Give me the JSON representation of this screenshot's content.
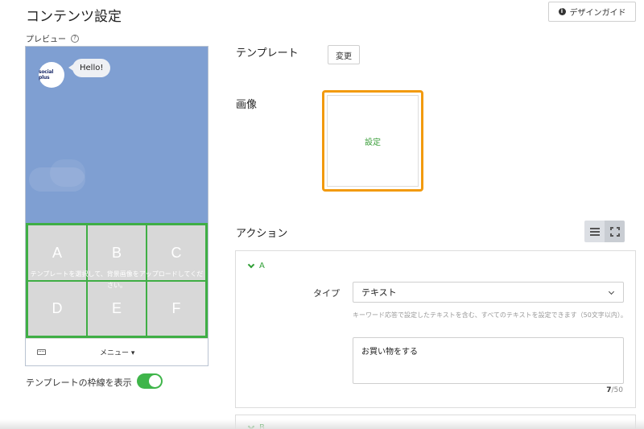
{
  "header": {
    "title": "コンテンツ設定",
    "design_guide_label": "デザインガイド",
    "design_guide_icon": "info-icon"
  },
  "preview": {
    "label": "プレビュー",
    "help_icon": "?",
    "bot_name_logo": "social plus",
    "greeting": "Hello!",
    "cells": [
      "A",
      "B",
      "C",
      "D",
      "E",
      "F"
    ],
    "overlay_text": "テンプレートを選択して、背景画像をアップロードしてください。",
    "menu_label": "メニュー ▾",
    "keyboard_icon": "keyboard-icon"
  },
  "toggle": {
    "label": "テンプレートの枠線を表示",
    "on": true
  },
  "template": {
    "label": "テンプレート",
    "change_label": "変更"
  },
  "image": {
    "label": "画像",
    "set_label": "設定"
  },
  "actions": {
    "label": "アクション",
    "view_modes": [
      "list-icon",
      "expand-icon"
    ],
    "items": [
      {
        "name": "A",
        "type_label": "タイプ",
        "type_value": "テキスト",
        "hint": "キーワード応答で設定したテキストを含む、すべてのテキストを設定できます（50文字以内）。",
        "text": "お買い物をする",
        "count": "7",
        "max": "/50"
      },
      {
        "name": "B"
      }
    ]
  },
  "colors": {
    "accent_green": "#3fae45",
    "highlight_orange": "#f29a0f",
    "chat_background": "#7f9fd2"
  }
}
